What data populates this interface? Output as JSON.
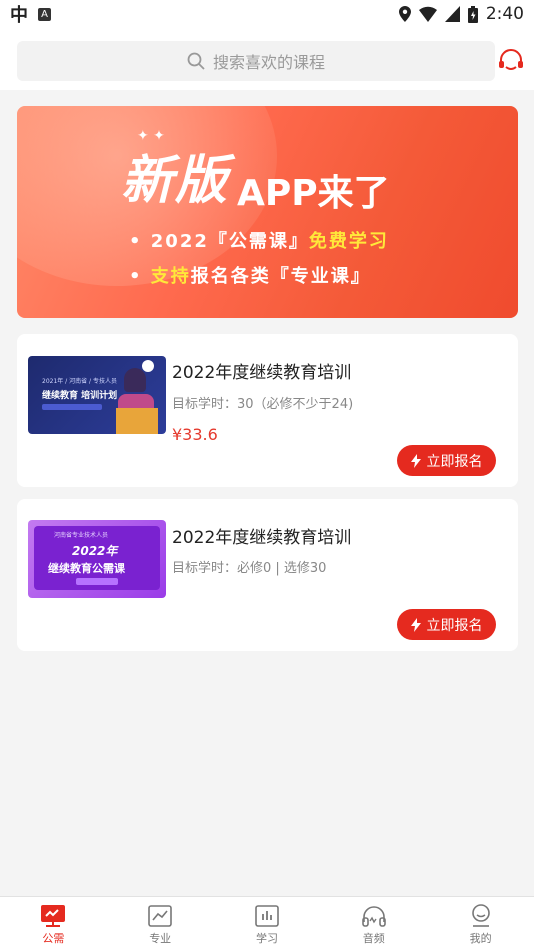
{
  "status_bar": {
    "time": "2:40",
    "badge": "A"
  },
  "search": {
    "placeholder": "搜索喜欢的课程"
  },
  "banner": {
    "big_text": "新版",
    "app_text": "APP来了",
    "line1_a": "• 2022『公需课』",
    "line1_b": "免费学习",
    "line2_a": "• ",
    "line2_b": "支持",
    "line2_c": "报名各类『专业课』"
  },
  "courses": [
    {
      "title": "2022年度继续教育培训",
      "sub": "目标学时：30（必修不少于24)",
      "price": "¥33.6",
      "button": "立即报名",
      "thumb_line1": "2021年 / 河南省 / 专技人员",
      "thumb_line2": "继续教育 培训计划"
    },
    {
      "title": "2022年度继续教育培训",
      "sub": "目标学时：必修0 | 选修30",
      "price": "",
      "button": "立即报名",
      "thumb_line1": "2022年",
      "thumb_line2": "继续教育公需课",
      "thumb_line3": "河南省专业技术人员"
    }
  ],
  "tabs": [
    {
      "label": "公需",
      "icon": "public-course-icon"
    },
    {
      "label": "专业",
      "icon": "chart-icon"
    },
    {
      "label": "学习",
      "icon": "study-icon"
    },
    {
      "label": "音频",
      "icon": "headphones-icon"
    },
    {
      "label": "我的",
      "icon": "user-icon"
    }
  ],
  "colors": {
    "accent": "#e52a1f",
    "highlight": "#ffe83a"
  }
}
